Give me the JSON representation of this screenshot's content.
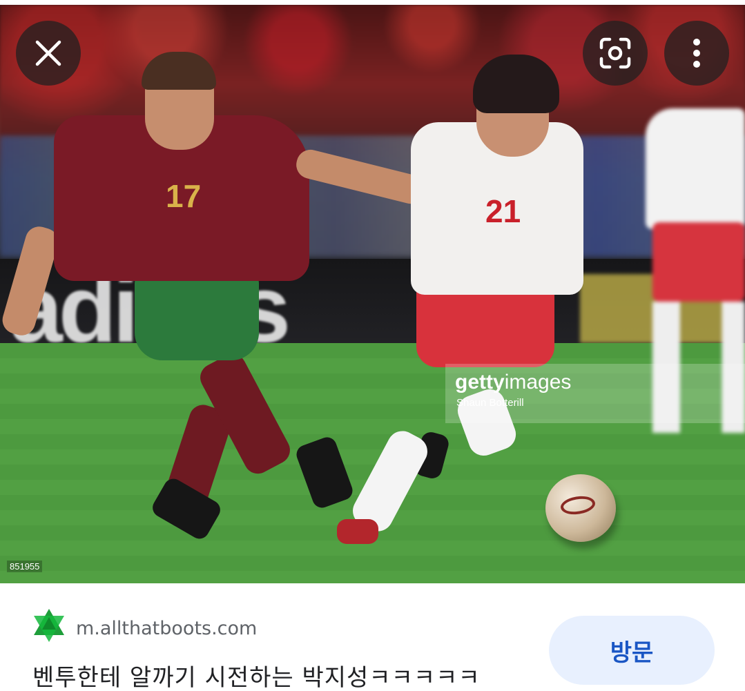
{
  "image": {
    "watermark_brand_bold": "getty",
    "watermark_brand_light": "images",
    "watermark_credit": "Shaun Botterill",
    "photo_id": "851955",
    "jersey_left_number": "17",
    "jersey_right_number": "21"
  },
  "overlay_buttons": {
    "close_icon": "close-icon",
    "lens_icon": "lens-icon",
    "more_icon": "more-vert-icon"
  },
  "result": {
    "site_domain": "m.allthatboots.com",
    "title": "벤투한테 알까기 시전하는 박지성ㅋㅋㅋㅋㅋ",
    "visit_label": "방문"
  },
  "colors": {
    "accent": "#1a56c4",
    "visit_bg": "#e8f0fe",
    "site_icon": "#1e9e3a"
  }
}
